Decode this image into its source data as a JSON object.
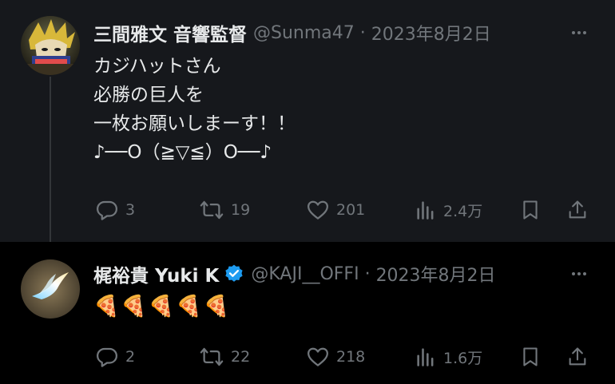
{
  "tweets": [
    {
      "display_name": "三間雅文 音響監督",
      "handle": "@Sunma47",
      "separator": "·",
      "date": "2023年8月2日",
      "verified": false,
      "avatar_icon": "character-avatar",
      "text": "カジハットさん\n必勝の巨人を\n一枚お願いしまーす！！\n♪──O（≧▽≦）O──♪",
      "stats": {
        "replies": "3",
        "retweets": "19",
        "likes": "201",
        "views": "2.4万"
      }
    },
    {
      "display_name": "梶裕貴 Yuki K",
      "handle": "@KAJI__OFFI",
      "separator": "·",
      "date": "2023年8月2日",
      "verified": true,
      "avatar_icon": "bird-avatar",
      "text": "🍕🍕🍕🍕🍕",
      "stats": {
        "replies": "2",
        "retweets": "22",
        "likes": "218",
        "views": "1.6万"
      }
    }
  ],
  "icons": {
    "more": "more-icon",
    "reply": "reply-icon",
    "retweet": "retweet-icon",
    "like": "heart-icon",
    "views": "views-icon",
    "bookmark": "bookmark-icon",
    "share": "share-icon"
  },
  "colors": {
    "background": "#000000",
    "highlighted_background": "#16181c",
    "text": "#e7e9ea",
    "secondary_text": "#71767b",
    "verified_badge": "#1d9bf0",
    "thread_line": "#333639"
  }
}
